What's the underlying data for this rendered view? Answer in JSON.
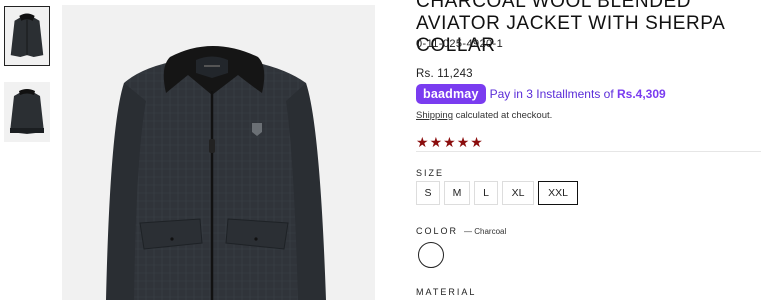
{
  "product": {
    "title": "CHARCOAL WOOL BLENDED AVIATOR JACKET WITH SHERPA COLLAR",
    "sku": "0-11-025-4920-1",
    "price": "Rs. 11,243",
    "rating_stars": 5
  },
  "installments": {
    "provider": "baadmay",
    "text": "Pay in 3 Installments of",
    "amount": "Rs.4,309"
  },
  "shipping": {
    "link_text": "Shipping",
    "rest": " calculated at checkout."
  },
  "size": {
    "label": "SIZE",
    "options": [
      "S",
      "M",
      "L",
      "XL",
      "XXL"
    ],
    "selected": "XXL"
  },
  "color": {
    "label": "COLOR",
    "value": "— Charcoal",
    "swatch_hex": "#ffffff"
  },
  "material": {
    "label": "MATERIAL"
  },
  "colors": {
    "star": "#8b0d0d",
    "baadmay": "#7a3cf0",
    "image_bg": "#f1f1f1"
  }
}
